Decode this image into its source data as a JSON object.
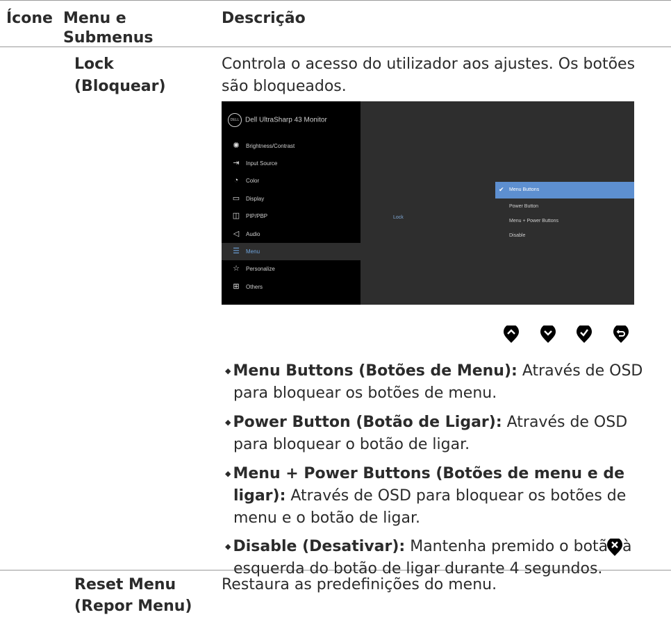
{
  "header": {
    "col_icon": "Ícone",
    "col_menu_line1": "Menu e",
    "col_menu_line2": "Submenus",
    "col_desc": "Descrição"
  },
  "lock": {
    "label_line1": "Lock",
    "label_line2": "(Bloquear)",
    "desc_line1": "Controla o acesso do utilizador aos ajustes. Os botões",
    "desc_line2": "são bloqueados."
  },
  "osd": {
    "title": "Dell UltraSharp 43 Monitor",
    "logo": "DELL",
    "menu_items": [
      {
        "label": "Brightness/Contrast",
        "icon": "sun-icon"
      },
      {
        "label": "Input Source",
        "icon": "input-icon"
      },
      {
        "label": "Color",
        "icon": "palette-icon"
      },
      {
        "label": "Display",
        "icon": "monitor-icon"
      },
      {
        "label": "PIP/PBP",
        "icon": "pip-icon"
      },
      {
        "label": "Audio",
        "icon": "speaker-icon"
      },
      {
        "label": "Menu",
        "icon": "menu-icon"
      },
      {
        "label": "Personalize",
        "icon": "star-icon"
      },
      {
        "label": "Others",
        "icon": "others-icon"
      }
    ],
    "selected_menu": "Menu",
    "submenu_label": "Lock",
    "options": [
      "Menu Buttons",
      "Power Button",
      "Menu + Power Buttons",
      "Disable"
    ],
    "selected_option": "Menu Buttons",
    "accent_color": "#5d8fd0"
  },
  "panel_buttons": [
    "chevron-up-icon",
    "chevron-down-icon",
    "check-icon",
    "back-icon"
  ],
  "bullets": {
    "b1_bold": "Menu Buttons (Botões de Menu):",
    "b1_text_a": " Através de OSD",
    "b1_text_b": "para bloquear os botões de menu.",
    "b2_bold": "Power Button (Botão de Ligar):",
    "b2_text_a": " Através de OSD",
    "b2_text_b": "para bloquear o botão de ligar.",
    "b3_bold_a": "Menu + Power Buttons (Botões de menu e de",
    "b3_bold_b": "ligar):",
    "b3_text_b": " Através de OSD para bloquear os botões de",
    "b3_text_c": "menu e o botão de ligar.",
    "b4_bold": "Disable (Desativar):",
    "b4_text_a": " Mantenha premido o botão",
    "b4_text_a2": " à",
    "b4_text_b": "esquerda do botão de ligar durante 4 segundos."
  },
  "reset": {
    "label_line1": "Reset Menu",
    "label_line2": "(Repor Menu)",
    "desc": "Restaura as predefinições do menu."
  }
}
